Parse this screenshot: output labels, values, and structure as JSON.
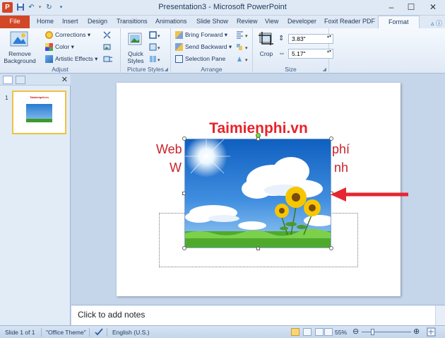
{
  "window": {
    "title": "Presentation3 - Microsoft PowerPoint",
    "app_icon_letter": "P"
  },
  "tabs": {
    "file": "File",
    "items": [
      "Home",
      "Insert",
      "Design",
      "Transitions",
      "Animations",
      "Slide Show",
      "Review",
      "View",
      "Developer",
      "Foxit Reader PDF"
    ],
    "active": "Format"
  },
  "ribbon": {
    "adjust": {
      "label": "Adjust",
      "remove_background": "Remove Background",
      "corrections": "Corrections",
      "color": "Color",
      "artistic_effects": "Artistic Effects"
    },
    "picture_styles": {
      "label": "Picture Styles",
      "quick_styles": "Quick Styles"
    },
    "arrange": {
      "label": "Arrange",
      "bring_forward": "Bring Forward",
      "send_backward": "Send Backward",
      "selection_pane": "Selection Pane"
    },
    "size": {
      "label": "Size",
      "crop": "Crop",
      "height": "3.83\"",
      "width": "5.17\""
    }
  },
  "thumbnails": {
    "number": "1",
    "title": "Taimienphi.vn"
  },
  "slide": {
    "heading": "Taimienphi.vn",
    "line1_left": "Web",
    "line1_right": "n phí",
    "line2_left": "W",
    "line2_right": "nh"
  },
  "notes": {
    "placeholder": "Click to add notes"
  },
  "status": {
    "slide_info": "Slide 1 of 1",
    "theme": "\"Office Theme\"",
    "language": "English (U.S.)",
    "zoom": "55%",
    "zoom_level": 0.55
  },
  "colors": {
    "file_tab": "#d24726",
    "heading": "#e8232a",
    "body_text": "#c9222a",
    "arrow": "#e62630"
  }
}
